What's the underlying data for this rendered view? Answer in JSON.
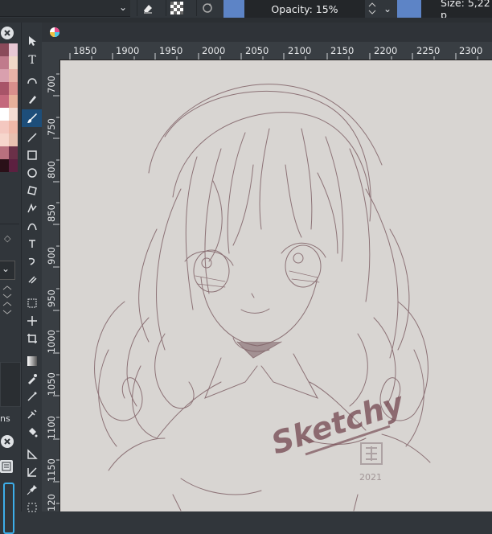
{
  "toolbar": {
    "opacity_label": "Opacity: 15%",
    "size_label": "Size: 5,22 p",
    "accent_color": "#5d84c6"
  },
  "icons": {
    "dropdown": "chevron-down-icon",
    "eraser": "eraser-icon",
    "alpha": "alpha-lock-icon",
    "reload": "reload-icon",
    "stepper": "stepper-icon",
    "document": "document-icon"
  },
  "ruler": {
    "horizontal": [
      "1850",
      "1900",
      "1950",
      "2000",
      "2050",
      "2100",
      "2150",
      "2200",
      "2250",
      "2300"
    ],
    "vertical": [
      "700",
      "750",
      "800",
      "850",
      "900",
      "950",
      "1000",
      "1050",
      "1100",
      "1150",
      "120"
    ]
  },
  "docker": {
    "tab_fragment": "ns"
  },
  "artwork": {
    "signature": "Sketchy",
    "year": "2021",
    "stamp": "chibi-seal"
  }
}
